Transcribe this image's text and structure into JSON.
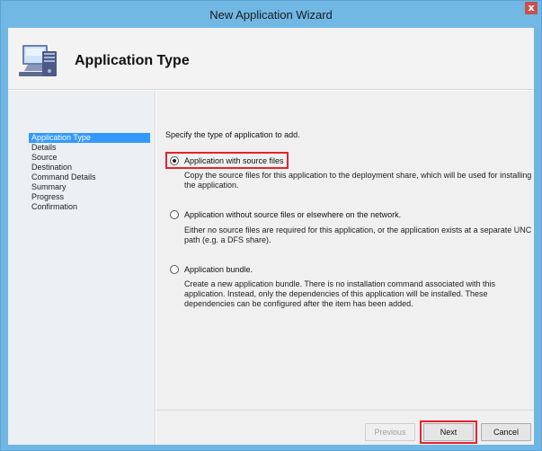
{
  "window": {
    "title": "New Application Wizard",
    "close_label": "x"
  },
  "header": {
    "title": "Application Type",
    "icon": "computer-icon"
  },
  "nav": {
    "items": [
      {
        "label": "Application Type",
        "selected": true
      },
      {
        "label": "Details",
        "selected": false
      },
      {
        "label": "Source",
        "selected": false
      },
      {
        "label": "Destination",
        "selected": false
      },
      {
        "label": "Command Details",
        "selected": false
      },
      {
        "label": "Summary",
        "selected": false
      },
      {
        "label": "Progress",
        "selected": false
      },
      {
        "label": "Confirmation",
        "selected": false
      }
    ]
  },
  "content": {
    "instruction": "Specify the type of application to add.",
    "options": [
      {
        "label": "Application with source files",
        "selected": true,
        "desc": "Copy the source files for this application to the deployment share, which will be used for installing the application."
      },
      {
        "label": "Application without source files or elsewhere on the network.",
        "selected": false,
        "desc": "Either no source files are required for this application, or the application exists at a separate UNC path (e.g. a DFS share)."
      },
      {
        "label": "Application bundle.",
        "selected": false,
        "desc": "Create a new application bundle.  There is no installation command associated with this application.  Instead, only the dependencies of this application will be installed.  These dependencies can be configured after the item has been added."
      }
    ]
  },
  "buttons": {
    "previous": "Previous",
    "next": "Next",
    "cancel": "Cancel"
  },
  "colors": {
    "title_bar": "#71b8e4",
    "selection": "#3399ff",
    "highlight": "#e5232e"
  }
}
